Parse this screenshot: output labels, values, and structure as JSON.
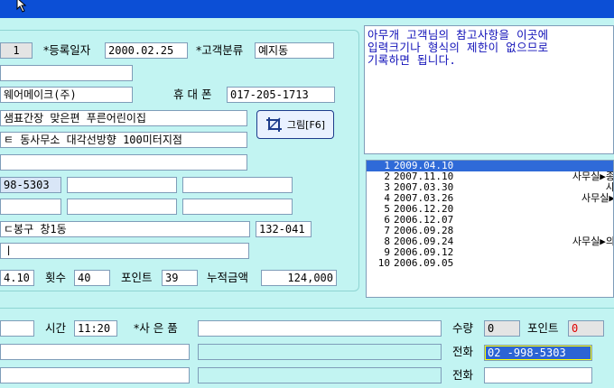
{
  "top": {
    "seq": "1",
    "reg_date_label": "*등록일자",
    "reg_date": "2000.02.25",
    "customer_class_label": "*고객분류",
    "customer_class": "예지동",
    "field_row2": "",
    "company": "웨어메이크(주)",
    "mobile_label": "휴 대 폰",
    "mobile": "017-205-1713",
    "address1": " 샘표간장 맞은편 푸른어린이집",
    "address2": "ㅌ 동사무소 대각선방향 100미터지점",
    "field_row6": "",
    "phone1": "98-5303",
    "phone2": "",
    "phone3": "",
    "phone4": "",
    "phone5": "",
    "phone6": "",
    "region": "ㄷ봉구 창1동",
    "zipcode": "132-041",
    "field_row10": "ㅣ",
    "last_date": "4.10",
    "count_label": "횟수",
    "count": "40",
    "points_label": "포인트",
    "points": "39",
    "total_label": "누적금액",
    "total": "124,000",
    "photo_button": "그림[F6]"
  },
  "memo": {
    "lines": [
      "아무개 고객님의 참고사항을 이곳에",
      "입력크기나 형식의 제한이 없으므로",
      "기록하면 됩니다."
    ]
  },
  "history": [
    {
      "num": "1",
      "date": "2009.04.10",
      "note": "",
      "selected": true
    },
    {
      "num": "2",
      "date": "2007.11.10",
      "note": "사무실▶종"
    },
    {
      "num": "3",
      "date": "2007.03.30",
      "note": "사"
    },
    {
      "num": "4",
      "date": "2007.03.26",
      "note": "사무실▶"
    },
    {
      "num": "5",
      "date": "2006.12.20",
      "note": ""
    },
    {
      "num": "6",
      "date": "2006.12.07",
      "note": ""
    },
    {
      "num": "7",
      "date": "2006.09.28",
      "note": ""
    },
    {
      "num": "8",
      "date": "2006.09.24",
      "note": "사무실▶의"
    },
    {
      "num": "9",
      "date": "2006.09.12",
      "note": ""
    },
    {
      "num": "10",
      "date": "2006.09.05",
      "note": ""
    }
  ],
  "bottom": {
    "time_label": "시간",
    "time": "11:20",
    "gift_label": "*사 은 품",
    "gift": "",
    "qty_label": "수량",
    "qty": "0",
    "points_label": "포인트",
    "points": "0",
    "phone_label": "전화",
    "phone": "02  -998-5303",
    "phone2_label": "전화",
    "phone2": ""
  },
  "colors": {
    "background": "#c2f4f2",
    "titlebar": "#0c4fd6",
    "selection": "#2f6ad8",
    "memo_text": "#1010b8",
    "highlight": "#ffff00"
  }
}
